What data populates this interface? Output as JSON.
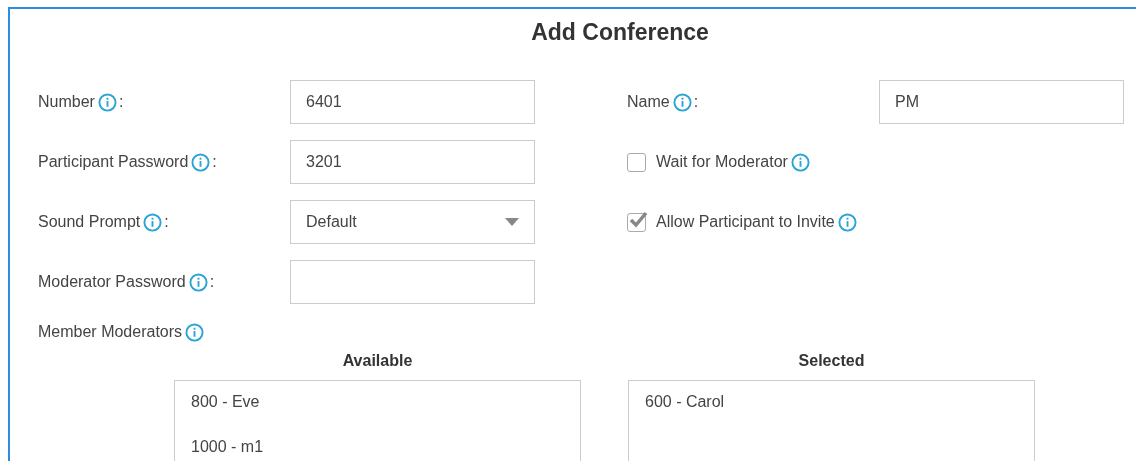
{
  "title": "Add Conference",
  "left_fields": [
    {
      "kind": "text",
      "label": "Number",
      "suffix": ":",
      "value": "6401"
    },
    {
      "kind": "text",
      "label": "Participant Password",
      "suffix": ":",
      "value": "3201"
    },
    {
      "kind": "select",
      "label": "Sound Prompt",
      "suffix": ":",
      "value": "Default"
    },
    {
      "kind": "text",
      "label": "Moderator Password",
      "suffix": ":"
    }
  ],
  "right_fields": [
    {
      "kind": "text",
      "label": "Name",
      "suffix": ":",
      "value": "PM"
    },
    {
      "kind": "checkbox",
      "label": "Wait for Moderator",
      "checked": false
    },
    {
      "kind": "checkbox",
      "label": "Allow Participant to Invite",
      "checked": true
    }
  ],
  "member_moderators": {
    "label": "Member Moderators",
    "available": {
      "heading": "Available",
      "items": [
        "800 - Eve",
        "1000 - m1"
      ]
    },
    "selected": {
      "heading": "Selected",
      "items": [
        "600 - Carol"
      ]
    }
  }
}
